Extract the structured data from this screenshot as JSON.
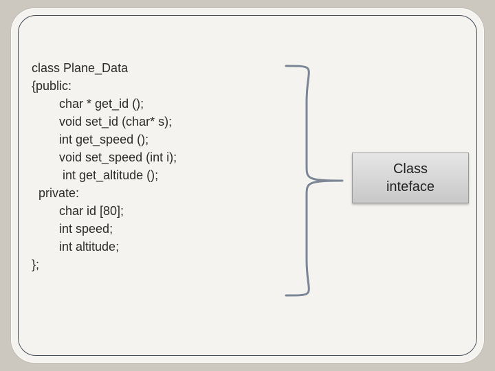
{
  "code": {
    "line0": "class Plane_Data",
    "line1": "{public:",
    "line2": "        char * get_id ();",
    "line3": "        void set_id (char* s);",
    "line4": "        int get_speed ();",
    "line5": "        void set_speed (int i);",
    "line6": "         int get_altitude ();",
    "line7": "  private:",
    "line8": "        char id [80];",
    "line9": "        int speed;",
    "line10": "        int altitude;",
    "line11": "};"
  },
  "label": {
    "line1": "Class",
    "line2": "inteface"
  }
}
